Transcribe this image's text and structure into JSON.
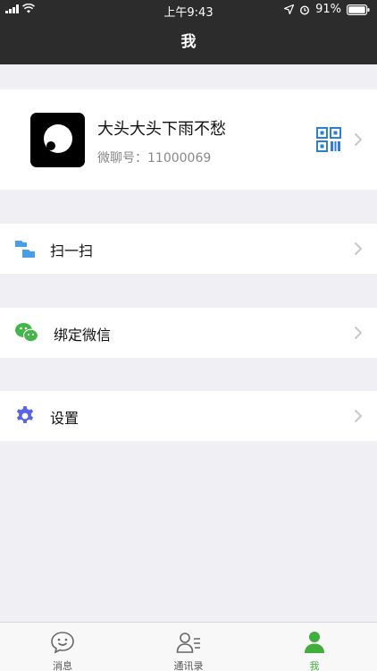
{
  "status_bar": {
    "time": "上午9:43",
    "battery": "91%"
  },
  "nav": {
    "title": "我"
  },
  "profile": {
    "name": "大头大头下雨不愁",
    "id_label": "微聊号：11000069"
  },
  "menu": [
    {
      "label": "扫一扫",
      "icon": "scan-icon"
    },
    {
      "label": "绑定微信",
      "icon": "wechat-icon"
    },
    {
      "label": "设置",
      "icon": "gear-icon"
    }
  ],
  "tabs": [
    {
      "label": "消息",
      "icon": "message-icon",
      "active": false
    },
    {
      "label": "通讯录",
      "icon": "contacts-icon",
      "active": false
    },
    {
      "label": "我",
      "icon": "person-icon",
      "active": true
    }
  ],
  "colors": {
    "accent_green": "#3fae3c",
    "qr_blue": "#2d7fd1",
    "gear_purple": "#5a63e8"
  }
}
